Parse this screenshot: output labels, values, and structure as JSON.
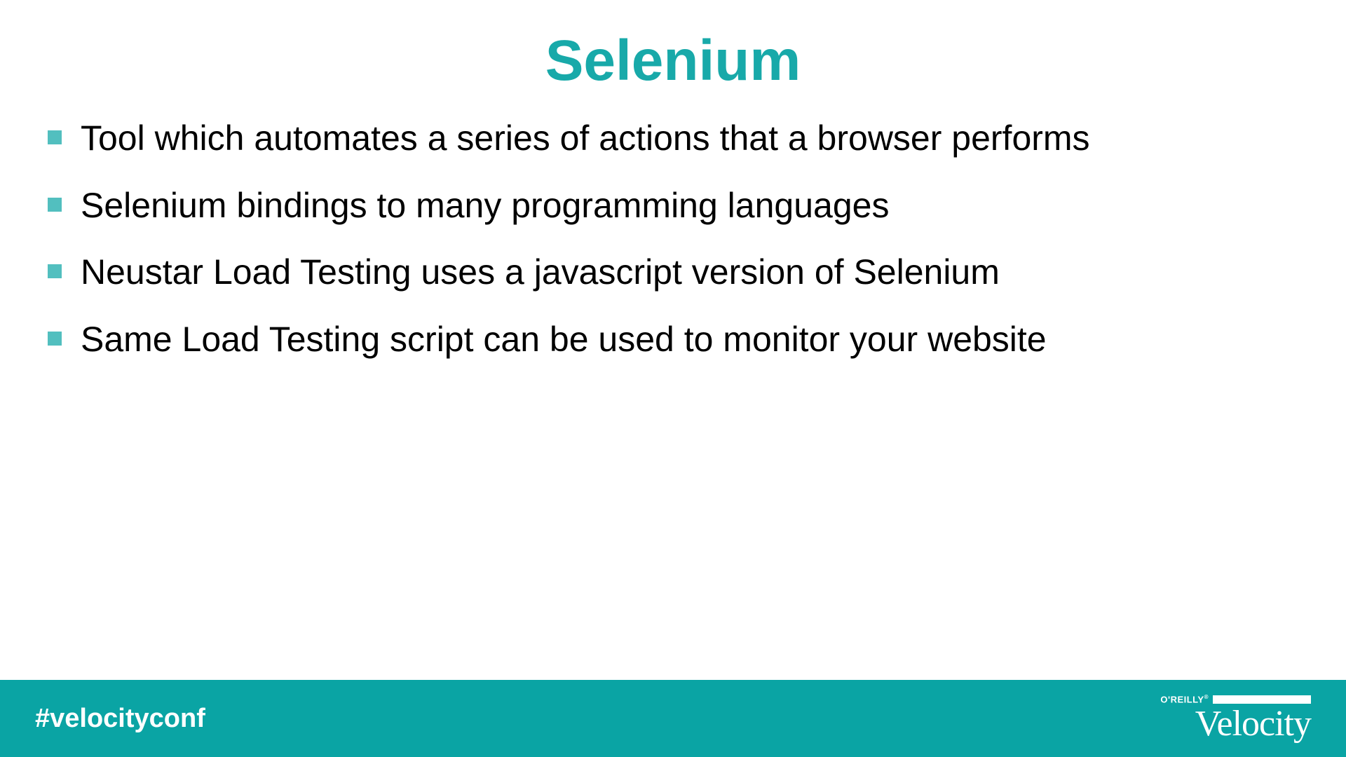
{
  "title": "Selenium",
  "bullets": {
    "b0": "Tool which automates a series of actions that a browser performs",
    "b1": "Selenium bindings to many programming languages",
    "b2": "Neustar Load Testing uses a javascript version of Selenium",
    "b3": "Same Load Testing script can be used to monitor your website"
  },
  "footer": {
    "hashtag": "#velocityconf",
    "brand_small": "O'REILLY",
    "brand_main": "Velocity"
  }
}
